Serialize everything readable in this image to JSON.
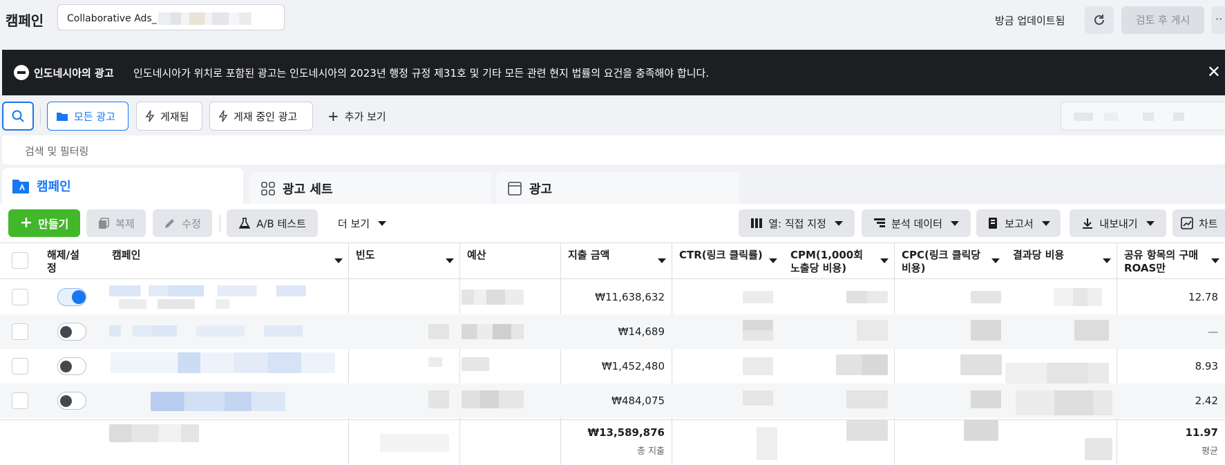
{
  "header": {
    "title": "캠페인",
    "campaign_select_value": "Collaborative Ads_",
    "updated_text": "방금 업데이트됨",
    "review_button": "검토 후 게시",
    "more_glyph": "··"
  },
  "banner": {
    "title": "인도네시아의 광고",
    "text": "인도네시아가 위치로 포함된 광고는 인도네시아의 2023년 행정 규정 제31호 및 기타 모든 관련 현지 법률의 요건을 충족해야 합니다.",
    "close": "✕"
  },
  "filter_tabs": [
    {
      "label": "모든 광고",
      "icon": "folder-icon",
      "active": true
    },
    {
      "label": "게재됨",
      "icon": "bolt-icon",
      "active": false
    },
    {
      "label": "게재 중인 광고",
      "icon": "bolt-icon",
      "active": false
    },
    {
      "label": "추가 보기",
      "icon": "plus-icon",
      "active": false
    }
  ],
  "search": {
    "placeholder": "검색 및 필터링"
  },
  "level_tabs": [
    {
      "label": "캠페인",
      "icon": "campaign-folder-icon"
    },
    {
      "label": "광고 세트",
      "icon": "grid-icon"
    },
    {
      "label": "광고",
      "icon": "ad-frame-icon"
    }
  ],
  "toolbar": {
    "create": "만들기",
    "duplicate": "복제",
    "edit": "수정",
    "ab_test": "A/B 테스트",
    "more_view": "더 보기",
    "columns": "열: 직접 지정",
    "breakdown": "분석 데이터",
    "reports": "보고서",
    "export": "내보내기",
    "charts": "차트"
  },
  "table": {
    "columns": [
      "해제/설정",
      "캠페인",
      "빈도",
      "예산",
      "지출 금액",
      "CTR(링크 클릭률)",
      "CPM(1,000회 노출당 비용)",
      "CPC(링크 클릭당 비용)",
      "결과당 비용",
      "공유 항목의 구매 ROAS만"
    ],
    "rows": [
      {
        "toggle_on": true,
        "spend": "₩11,638,632",
        "roas": "12.78"
      },
      {
        "toggle_on": false,
        "spend": "₩14,689",
        "roas": "—"
      },
      {
        "toggle_on": false,
        "spend": "₩1,452,480",
        "roas": "8.93"
      },
      {
        "toggle_on": false,
        "spend": "₩484,075",
        "roas": "2.42"
      }
    ],
    "total": {
      "spend": "₩13,589,876",
      "spend_label": "총 지출",
      "roas": "11.97",
      "roas_label": "평균"
    }
  },
  "colors": {
    "accent": "#1877f2",
    "create": "#42b72a",
    "banner": "#1c1e21"
  }
}
